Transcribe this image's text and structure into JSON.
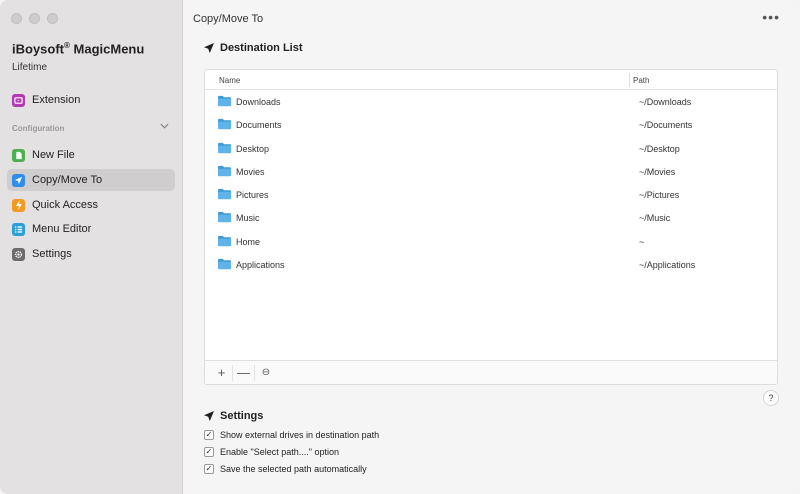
{
  "sidebar": {
    "app_name": "iBoysoft",
    "app_name_sup": "®",
    "app_name_suffix": "MagicMenu",
    "license": "Lifetime",
    "extension_label": "Extension",
    "section_label": "Configuration",
    "items": [
      {
        "label": "New File",
        "icon": "new-file-icon",
        "color": "#4cb04f"
      },
      {
        "label": "Copy/Move To",
        "icon": "paper-plane-icon",
        "color": "#2f8ee9",
        "active": true
      },
      {
        "label": "Quick Access",
        "icon": "lightning-icon",
        "color": "#f39a20"
      },
      {
        "label": "Menu Editor",
        "icon": "list-icon",
        "color": "#2c9fd9"
      },
      {
        "label": "Settings",
        "icon": "gear-icon",
        "color": "#6e6c6d"
      }
    ]
  },
  "main": {
    "title": "Copy/Move To",
    "more_label": "•••",
    "destination_title": "Destination List",
    "columns": {
      "name": "Name",
      "path": "Path"
    },
    "rows": [
      {
        "name": "Downloads",
        "path": "~/Downloads"
      },
      {
        "name": "Documents",
        "path": "~/Documents"
      },
      {
        "name": "Desktop",
        "path": "~/Desktop"
      },
      {
        "name": "Movies",
        "path": "~/Movies"
      },
      {
        "name": "Pictures",
        "path": "~/Pictures"
      },
      {
        "name": "Music",
        "path": "~/Music"
      },
      {
        "name": "Home",
        "path": "~"
      },
      {
        "name": "Applications",
        "path": "~/Applications"
      }
    ],
    "footer_buttons": {
      "add": "+",
      "remove": "—",
      "edit": "⊖"
    },
    "help_label": "?",
    "settings_title": "Settings",
    "settings": [
      {
        "label": "Show external drives in destination path",
        "checked": true
      },
      {
        "label": "Enable \"Select path....\" option",
        "checked": true
      },
      {
        "label": "Save the selected path automatically",
        "checked": true
      }
    ],
    "check_mark": "✓"
  },
  "colors": {
    "folder": "#5fb3e8",
    "folder_dark": "#3e9bd6",
    "sidebar_bg": "#e4e1e3",
    "active_bg": "#d0cdcf"
  }
}
